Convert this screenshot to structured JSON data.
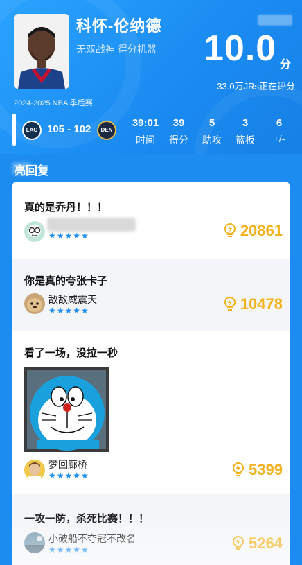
{
  "player": {
    "name": "科怀-伦纳德",
    "subtitle": "无双战神 得分机器",
    "season": "2024-2025 NBA 季后赛"
  },
  "rating": {
    "value": "10.0",
    "unit": "分",
    "count": "33.0万JRs正在评分"
  },
  "game": {
    "home_abbr": "LAC",
    "away_abbr": "DEN",
    "score": "105 - 102",
    "stats": [
      {
        "value": "39:01",
        "label": "时间"
      },
      {
        "value": "39",
        "label": "得分"
      },
      {
        "value": "5",
        "label": "助攻"
      },
      {
        "value": "3",
        "label": "篮板"
      },
      {
        "value": "6",
        "label": "+/-"
      }
    ]
  },
  "section": {
    "title": "亮回复"
  },
  "comments": [
    {
      "text": "真的是乔丹！！！",
      "user": "",
      "stars": "★★★★★",
      "likes": "20861",
      "avatar": "glasses-avatar"
    },
    {
      "text": "你是真的夸张卡子",
      "user": "敌敌威震天",
      "stars": "★★★★★",
      "likes": "10478",
      "avatar": "dog-avatar"
    },
    {
      "text": "看了一场，没拉一秒",
      "user": "梦回廊桥",
      "stars": "★★★★★",
      "likes": "5399",
      "avatar": "player-avatar"
    },
    {
      "text": "一攻一防，杀死比赛！！！",
      "user": "小破船不夺冠不改名",
      "stars": "★★★★★",
      "likes": "5264",
      "avatar": "scene-avatar"
    }
  ],
  "colors": {
    "primary": "#1d8cf0",
    "star": "#1f8ef1",
    "likes": "#f3b21b"
  }
}
